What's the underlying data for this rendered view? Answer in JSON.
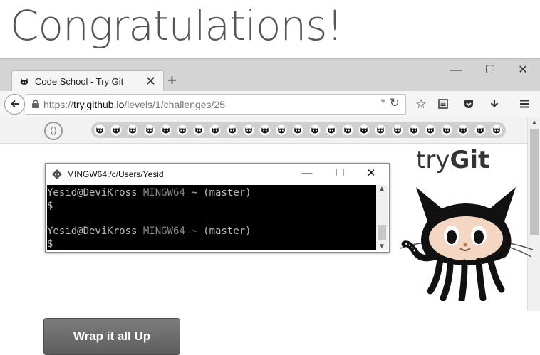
{
  "heading": "Congratulations!",
  "browser": {
    "tab": {
      "title": "Code School - Try Git",
      "close": "✕"
    },
    "new_tab": "+",
    "window_controls": {
      "minimize": "—",
      "maximize": "☐",
      "close": "✕"
    },
    "address": {
      "protocol": "https://",
      "host": "try.github.io",
      "path": "/levels/1/challenges/25"
    },
    "toolbar_icons": [
      "star-icon",
      "reader-view-icon",
      "pocket-icon",
      "download-icon",
      "menu-icon"
    ]
  },
  "page": {
    "levels_button": "⟨⟩",
    "challenge_count": 25,
    "logo": {
      "light": "try",
      "bold": "Git"
    },
    "wrap_button": "Wrap it all Up"
  },
  "terminal": {
    "title": "MINGW64:/c/Users/Yesid",
    "lines": [
      {
        "prompt": "Yesid@DeviKross",
        "env": "MINGW64",
        "rest": " ~ (master)"
      },
      {
        "text": "$"
      },
      {
        "prompt": "Yesid@DeviKross",
        "env": "MINGW64",
        "rest": " ~ (master)"
      },
      {
        "text": "$"
      }
    ]
  },
  "colors": {
    "heading_text": "#555555",
    "terminal_bg": "#000000",
    "button_bg": "#6b6b6b"
  }
}
